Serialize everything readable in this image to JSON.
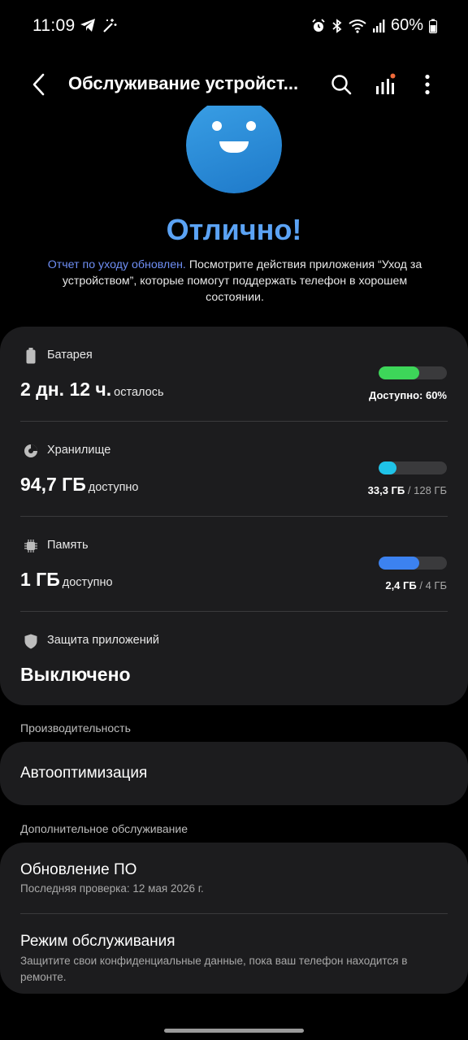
{
  "status_bar": {
    "time": "11:09",
    "battery_pct": "60%",
    "icons": [
      "telegram-icon",
      "magic-wand-icon",
      "alarm-icon",
      "bluetooth-icon",
      "wifi-icon",
      "signal-icon",
      "battery-icon"
    ]
  },
  "app_bar": {
    "title": "Обслуживание устройст...",
    "icons": [
      "back-arrow-icon",
      "search-icon",
      "stats-icon",
      "more-vert-icon"
    ]
  },
  "status": {
    "title": "Отлично!",
    "desc_link": "Отчет по уходу обновлен.",
    "desc_rest": " Посмотрите действия приложения “Уход за устройством”, которые помогут поддержать телефон в хорошем состоянии."
  },
  "battery": {
    "label": "Батарея",
    "value": "2 дн. 12 ч.",
    "value_suffix": "осталось",
    "note": "Доступно: 60%",
    "fill_fraction": 0.6,
    "color": "#3dd659"
  },
  "storage": {
    "label": "Хранилище",
    "value": "94,7 ГБ",
    "value_suffix": "доступно",
    "note_used": "33,3 ГБ",
    "note_total": " / 128 ГБ",
    "fill_fraction": 0.26,
    "color": "#1fc3e8"
  },
  "memory": {
    "label": "Память",
    "value": "1 ГБ",
    "value_suffix": "доступно",
    "note_used": "2,4 ГБ",
    "note_total": " / 4 ГБ",
    "fill_fraction": 0.6,
    "color": "#3c82f0"
  },
  "app_protection": {
    "label": "Защита приложений",
    "value": "Выключено"
  },
  "performance": {
    "header": "Производительность",
    "auto_opt": "Автооптимизация"
  },
  "extra": {
    "header": "Дополнительное обслуживание",
    "software_update": {
      "title": "Обновление ПО",
      "subtitle": "Последняя проверка: 12 мая 2026 г."
    },
    "maintenance_mode": {
      "title": "Режим обслуживания",
      "subtitle": "Защитите свои конфиденциальные данные, пока ваш телефон находится в ремонте."
    }
  }
}
